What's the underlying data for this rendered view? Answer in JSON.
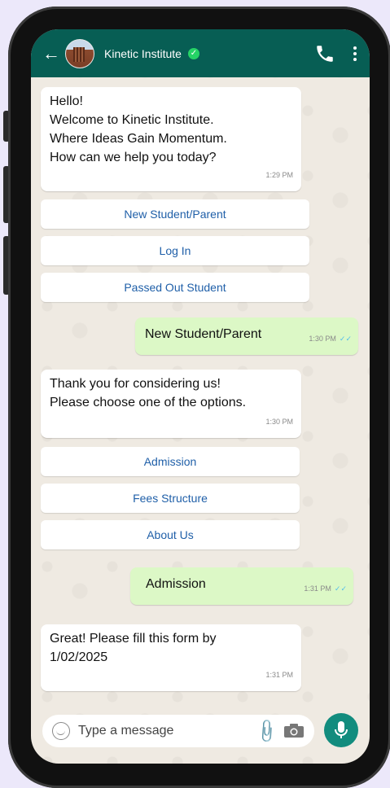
{
  "header": {
    "back_glyph": "←",
    "title": "Kinetic Institute",
    "verified_glyph": "✓"
  },
  "messages": {
    "welcome": {
      "text": "Hello!\nWelcome to Kinetic Institute.\nWhere Ideas Gain Momentum.\nHow can we help you today?",
      "time": "1:29 PM"
    },
    "options1": [
      "New Student/Parent",
      "Log In",
      "Passed Out Student"
    ],
    "reply1": {
      "text": "New Student/Parent",
      "time": "1:30 PM",
      "ticks": "✓✓"
    },
    "thanks": {
      "text": "Thank you for considering us!\nPlease choose one of the options.",
      "time": "1:30 PM"
    },
    "options2": [
      "Admission",
      "Fees Structure",
      "About Us"
    ],
    "reply2": {
      "text": "Admission",
      "time": "1:31 PM",
      "ticks": "✓✓"
    },
    "form": {
      "text": "Great! Please fill this form by\n1/02/2025",
      "time": "1:31 PM"
    }
  },
  "composer": {
    "placeholder": "Type a message",
    "attach_glyph": "📎"
  },
  "colors": {
    "header": "#075e54",
    "outgoing": "#dcf8c6",
    "mic": "#128c7e",
    "link": "#1f5fa8"
  }
}
